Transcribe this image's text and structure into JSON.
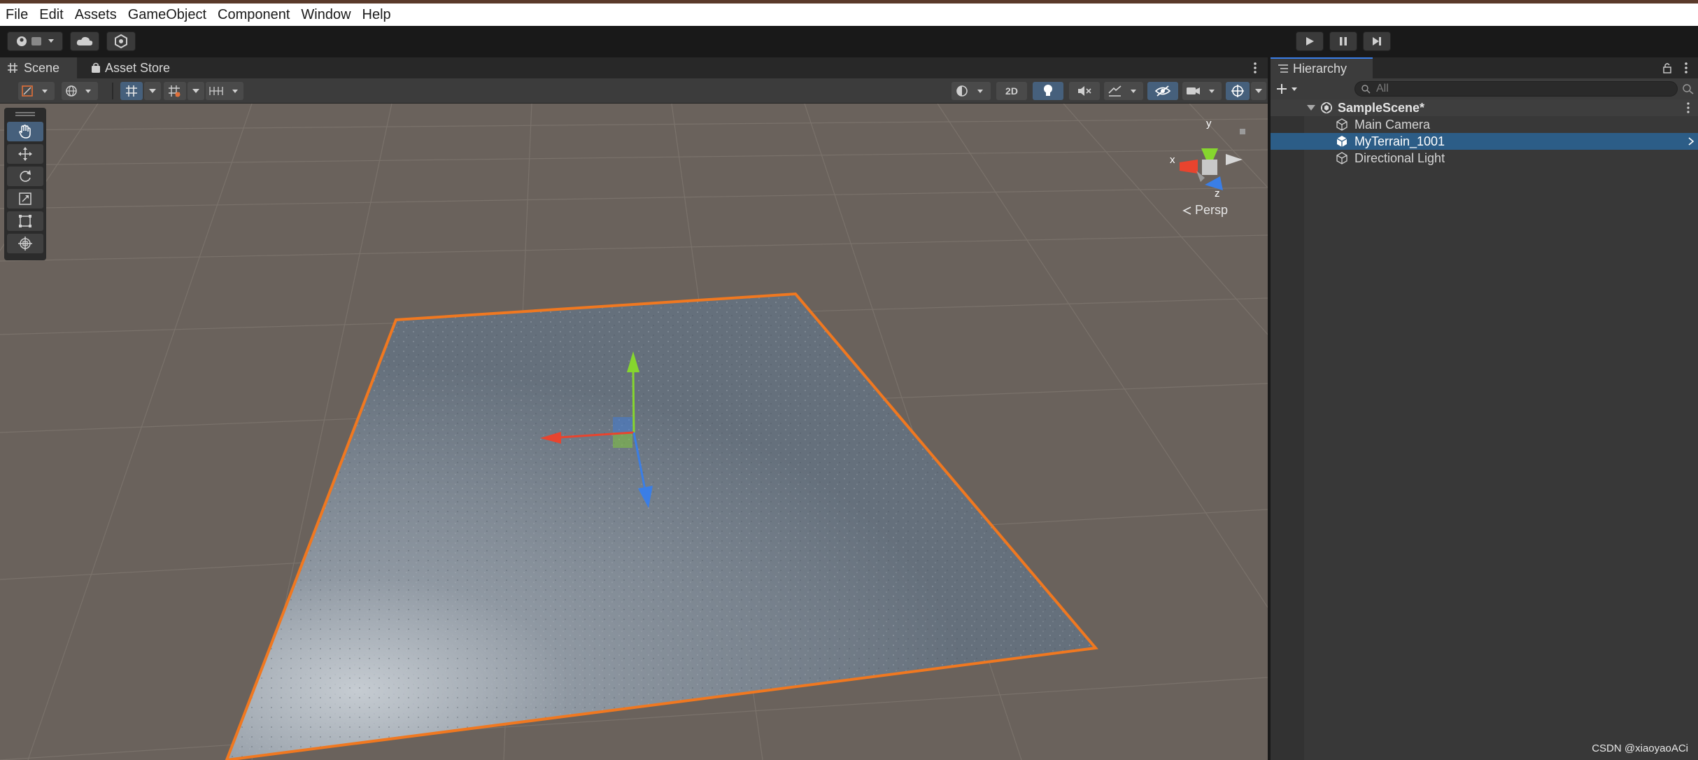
{
  "menu": [
    "File",
    "Edit",
    "Assets",
    "GameObject",
    "Component",
    "Window",
    "Help"
  ],
  "scene_panel": {
    "tabs": [
      "Scene",
      "Asset Store"
    ],
    "toolbar_2d_label": "2D",
    "gizmo": {
      "x_label": "x",
      "y_label": "y",
      "z_label": "z",
      "projection_label": "Persp"
    }
  },
  "hierarchy": {
    "tab_label": "Hierarchy",
    "search_placeholder": "All",
    "scene_name": "SampleScene*",
    "items": [
      {
        "label": "Main Camera",
        "selected": false
      },
      {
        "label": "MyTerrain_1001",
        "selected": true
      },
      {
        "label": "Directional Light",
        "selected": false
      }
    ]
  },
  "colors": {
    "selection": "#2c5d87",
    "active_tool": "#46607c",
    "terrain_outline": "#f07820",
    "axis_x": "#e8442e",
    "axis_y": "#86d62e",
    "axis_z": "#3a7ee6"
  },
  "watermark": "CSDN @xiaoyaoACi"
}
